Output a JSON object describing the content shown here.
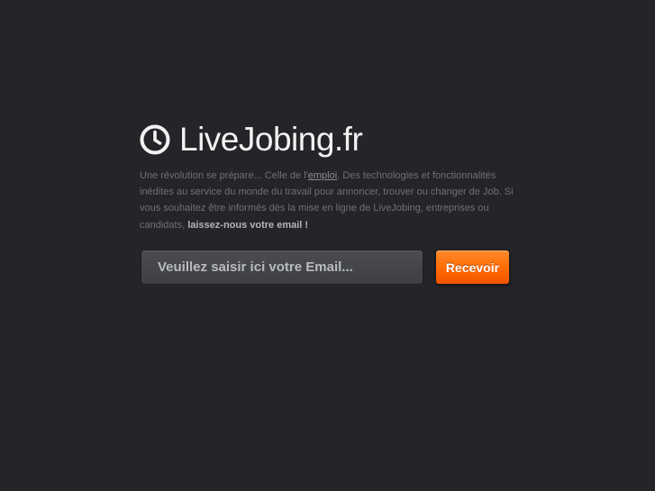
{
  "logo": {
    "icon": "clock-icon",
    "text": "LiveJobing.fr"
  },
  "intro": {
    "part1": "Une révolution se prépare... Celle de l'",
    "link": "emploi",
    "part2": ". Des technologies et fonctionnalités inédites au service du monde du travail pour annoncer, trouver ou changer de Job. Si vous souhaitez être informés dès la mise en ligne de LiveJobing, entreprises ou candidats, ",
    "cta": "laissez-nous votre email !"
  },
  "form": {
    "email_placeholder": "Veuillez saisir ici votre Email...",
    "email_value": "",
    "submit_label": "Recevoir"
  },
  "colors": {
    "background": "#242528",
    "accent": "#ff6a00",
    "logo_text": "#f2f2f2"
  }
}
